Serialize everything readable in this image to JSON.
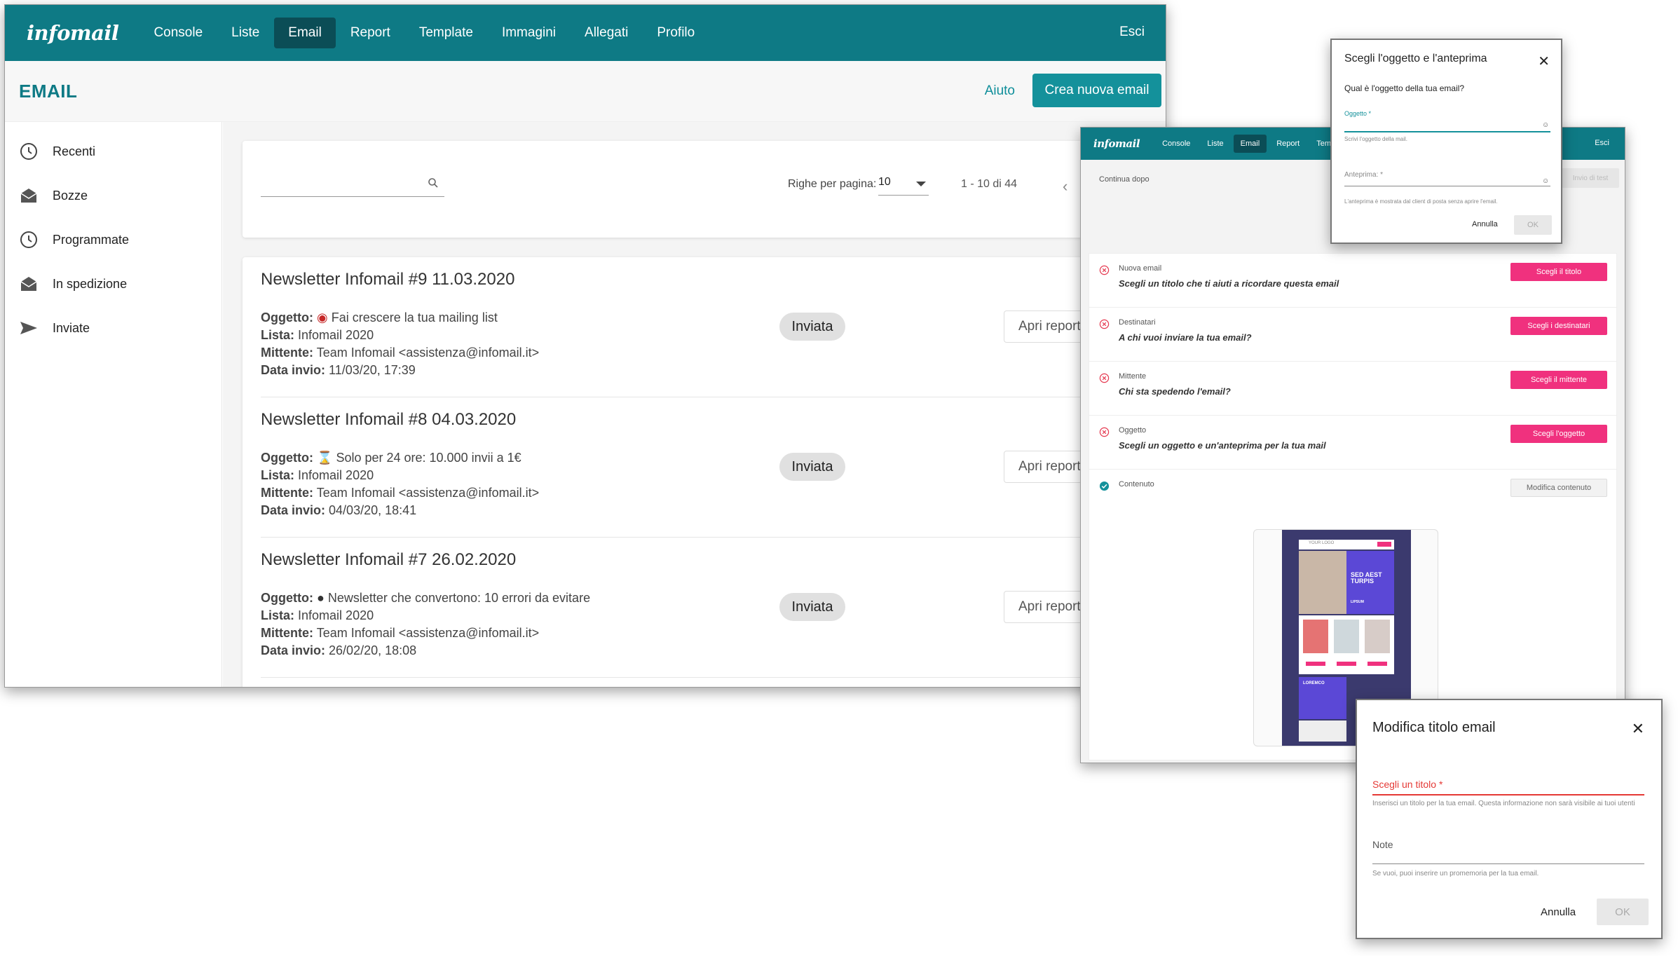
{
  "main": {
    "logo": "infomail",
    "nav": [
      "Console",
      "Liste",
      "Email",
      "Report",
      "Template",
      "Immagini",
      "Allegati",
      "Profilo"
    ],
    "nav_active": "Email",
    "logout": "Esci",
    "page_title": "EMAIL",
    "help": "Aiuto",
    "create_button": "Crea nuova email",
    "sidebar": [
      {
        "label": "Recenti",
        "icon": "clock-icon"
      },
      {
        "label": "Bozze",
        "icon": "envelope-open-icon"
      },
      {
        "label": "Programmate",
        "icon": "clock-icon"
      },
      {
        "label": "In spedizione",
        "icon": "envelope-open-icon"
      },
      {
        "label": "Inviate",
        "icon": "send-icon"
      }
    ],
    "search": {
      "placeholder": ""
    },
    "rows_per_page_label": "Righe per pagina:",
    "rows_per_page_value": "10",
    "range": "1 - 10 di 44",
    "emails": [
      {
        "title": "Newsletter Infomail #9 11.03.2020",
        "oggetto_label": "Oggetto:",
        "oggetto": "Fai crescere la tua mailing list",
        "lista_label": "Lista:",
        "lista": "Infomail 2020",
        "mittente_label": "Mittente:",
        "mittente": "Team Infomail <assistenza@infomail.it>",
        "data_label": "Data invio:",
        "data": "11/03/20, 17:39",
        "status": "Inviata",
        "action": "Apri report"
      },
      {
        "title": "Newsletter Infomail #8 04.03.2020",
        "oggetto_label": "Oggetto:",
        "oggetto": "Solo per 24 ore: 10.000 invii a 1€",
        "lista_label": "Lista:",
        "lista": "Infomail 2020",
        "mittente_label": "Mittente:",
        "mittente": "Team Infomail <assistenza@infomail.it>",
        "data_label": "Data invio:",
        "data": "04/03/20, 18:41",
        "status": "Inviata",
        "action": "Apri report"
      },
      {
        "title": "Newsletter Infomail #7 26.02.2020",
        "oggetto_label": "Oggetto:",
        "oggetto": "Newsletter che convertono: 10 errori da evitare",
        "lista_label": "Lista:",
        "lista": "Infomail 2020",
        "mittente_label": "Mittente:",
        "mittente": "Team Infomail <assistenza@infomail.it>",
        "data_label": "Data invio:",
        "data": "26/02/20, 18:08",
        "status": "Inviata",
        "action": "Apri report"
      }
    ]
  },
  "editor": {
    "logo": "infomail",
    "nav": [
      "Console",
      "Liste",
      "Email",
      "Report",
      "Templa"
    ],
    "logout": "Esci",
    "continue_later": "Continua dopo",
    "test_send": "Invio di test",
    "steps": [
      {
        "label": "Nuova email",
        "desc": "Scegli un titolo che ti aiuti a ricordare questa email",
        "button": "Scegli il titolo",
        "done": false
      },
      {
        "label": "Destinatari",
        "desc": "A chi vuoi inviare la tua email?",
        "button": "Scegli i destinatari",
        "done": false
      },
      {
        "label": "Mittente",
        "desc": "Chi sta spedendo l'email?",
        "button": "Scegli il mittente",
        "done": false
      },
      {
        "label": "Oggetto",
        "desc": "Scegli un oggetto e un'anteprima per la tua mail",
        "button": "Scegli l'oggetto",
        "done": false
      },
      {
        "label": "Contenuto",
        "desc": "",
        "button": "Modifica contenuto",
        "done": true
      }
    ],
    "preview": {
      "logo": "YOUR LOGO",
      "headline": "SED AEST TURPIS",
      "tag": "LIPSUM",
      "section": "LOREMCO"
    }
  },
  "modal_subject": {
    "title": "Scegli l'oggetto e l'anteprima",
    "question": "Qual è l'oggetto della tua email?",
    "field1_label": "Oggetto *",
    "field1_help": "Scrivi l'oggetto della mail.",
    "field2_label": "Anteprima: *",
    "field2_help": "L'anteprima è mostrata dal client di posta senza aprire l'email.",
    "cancel": "Annulla",
    "ok": "OK"
  },
  "modal_title": {
    "title": "Modifica titolo email",
    "field1_label": "Scegli un titolo *",
    "field1_help": "Inserisci un titolo per la tua email. Questa informazione non sarà visibile ai tuoi utenti",
    "field2_label": "Note",
    "field2_help": "Se vuoi, puoi inserire un promemoria per la tua email.",
    "cancel": "Annulla",
    "ok": "OK"
  },
  "colors": {
    "brand": "#0e7a85",
    "nav_active": "#0b4d56",
    "accent_pink": "#f0317e",
    "error_red": "#e53935"
  }
}
